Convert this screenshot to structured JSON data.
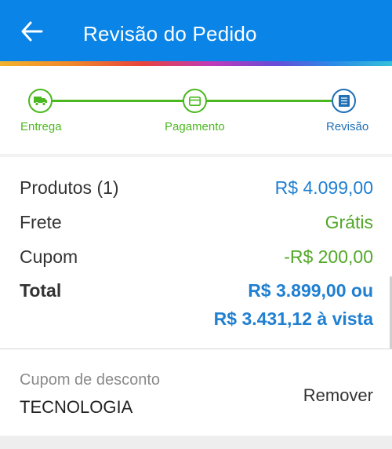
{
  "header": {
    "title": "Revisão do Pedido",
    "back_icon": "arrow-left-icon",
    "color": "#0a84e6"
  },
  "steps": [
    {
      "label": "Entrega",
      "icon": "truck-icon",
      "status": "done"
    },
    {
      "label": "Pagamento",
      "icon": "card-icon",
      "status": "done"
    },
    {
      "label": "Revisão",
      "icon": "receipt-icon",
      "status": "current"
    }
  ],
  "summary": {
    "products_label": "Produtos (1)",
    "products_value": "R$ 4.099,00",
    "shipping_label": "Frete",
    "shipping_value": "Grátis",
    "coupon_label": "Cupom",
    "coupon_value": "-R$ 200,00",
    "total_label": "Total",
    "total_value_line1": "R$ 3.899,00 ou",
    "total_value_line2": "R$ 3.431,12 à vista"
  },
  "coupon": {
    "label": "Cupom de desconto",
    "code": "TECNOLOGIA",
    "remove_label": "Remover"
  },
  "colors": {
    "accent_blue": "#1f7fd1",
    "success_green": "#4cb81f",
    "current_step": "#1f6fb5"
  }
}
